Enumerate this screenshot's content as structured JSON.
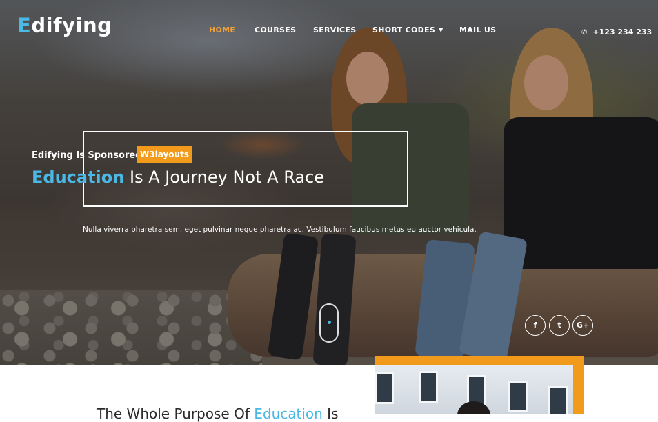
{
  "brand": {
    "first_letter": "E",
    "rest": "difying"
  },
  "nav": {
    "items": [
      {
        "label": "HOME",
        "active": true
      },
      {
        "label": "COURSES",
        "active": false
      },
      {
        "label": "SERVICES",
        "active": false
      },
      {
        "label": "SHORT CODES",
        "active": false,
        "dropdown": true
      },
      {
        "label": "MAIL US",
        "active": false
      }
    ]
  },
  "contact": {
    "phone": "+123 234 233",
    "icon": "phone-icon"
  },
  "hero": {
    "sponsor_text": "Edifying Is Sponsored By",
    "sponsor_badge": "W3layouts",
    "headline_highlight": "Education",
    "headline_rest": " Is A Journey Not A Race",
    "description": "Nulla viverra pharetra sem, eget pulvinar neque pharetra ac. Vestibulum faucibus metus eu auctor vehicula."
  },
  "social": [
    {
      "icon": "facebook-icon",
      "glyph": "f"
    },
    {
      "icon": "twitter-icon",
      "glyph": "t"
    },
    {
      "icon": "google-plus-icon",
      "glyph": "G+"
    }
  ],
  "about": {
    "title_part1": "The Whole Purpose Of ",
    "title_highlight": "Education",
    "title_part2": " Is"
  },
  "colors": {
    "accent_blue": "#4bb8e6",
    "accent_orange": "#f19a1c",
    "nav_active": "#f1a13a"
  }
}
